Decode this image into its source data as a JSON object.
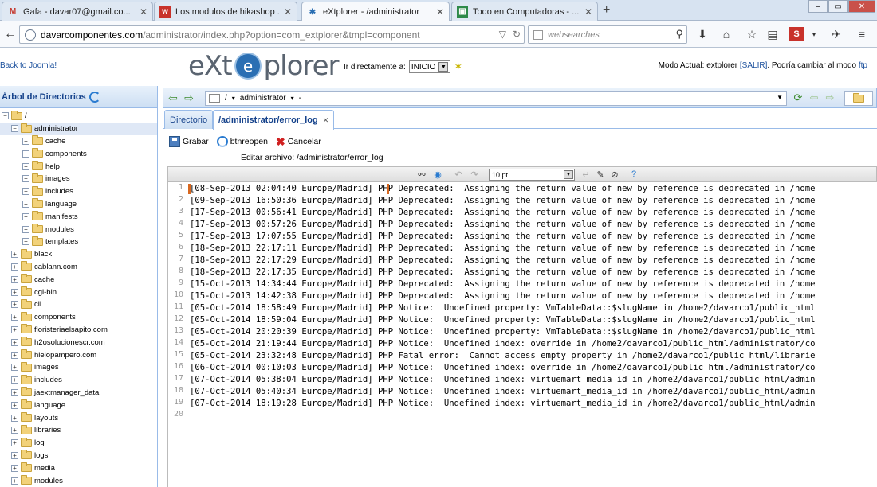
{
  "browser": {
    "tabs": [
      {
        "title": "Gafa - davar07@gmail.co...",
        "icon": "gmail-icon",
        "active": false
      },
      {
        "title": "Los modulos de hikashop ...",
        "icon": "site-icon",
        "active": false
      },
      {
        "title": "eXtplorer - /administrator",
        "icon": "extplorer-icon",
        "active": true
      },
      {
        "title": "Todo en Computadoras - ...",
        "icon": "page-icon",
        "active": false
      }
    ],
    "url_host": "davarcomponentes.com",
    "url_path": "/administrator/index.php?option=com_extplorer&tmpl=component",
    "search_placeholder": "websearches"
  },
  "header": {
    "back_link": "Back to Joomla!",
    "logo_left": "eXt",
    "logo_right": "plorer",
    "goto_label": "Ir directamente a:",
    "goto_value": "INICIO",
    "mode_prefix": "Modo Actual: extplorer",
    "mode_salir": "[SALIR]",
    "mode_middle": ". Podría cambiar al modo",
    "mode_ftp": "ftp"
  },
  "tree": {
    "title": "Árbol de Directorios",
    "root": "/",
    "selected": "administrator",
    "admin_children": [
      "cache",
      "components",
      "help",
      "images",
      "includes",
      "language",
      "manifests",
      "modules",
      "templates"
    ],
    "root_children": [
      "black",
      "cablann.com",
      "cache",
      "cgi-bin",
      "cli",
      "components",
      "floristeriaelsapito.com",
      "h2osolucionescr.com",
      "hielopampero.com",
      "images",
      "includes",
      "jaextmanager_data",
      "language",
      "layouts",
      "libraries",
      "log",
      "logs",
      "media",
      "modules"
    ]
  },
  "main": {
    "path_root": "/",
    "path_dir": "administrator",
    "path_sep": "-",
    "tab_directory": "Directorio",
    "tab_file": "/administrator/error_log",
    "save_label": "Grabar",
    "reopen_label": "btnreopen",
    "cancel_label": "Cancelar",
    "edit_label": "Editar archivo: /administrator/error_log",
    "font_size": "10 pt"
  },
  "editor": {
    "lines": [
      "[08-Sep-2013 02:04:40 Europe/Madrid] PHP Deprecated:  Assigning the return value of new by reference is deprecated in /home",
      "[09-Sep-2013 16:50:36 Europe/Madrid] PHP Deprecated:  Assigning the return value of new by reference is deprecated in /home",
      "[17-Sep-2013 00:56:41 Europe/Madrid] PHP Deprecated:  Assigning the return value of new by reference is deprecated in /home",
      "[17-Sep-2013 00:57:26 Europe/Madrid] PHP Deprecated:  Assigning the return value of new by reference is deprecated in /home",
      "[17-Sep-2013 17:07:55 Europe/Madrid] PHP Deprecated:  Assigning the return value of new by reference is deprecated in /home",
      "[18-Sep-2013 22:17:11 Europe/Madrid] PHP Deprecated:  Assigning the return value of new by reference is deprecated in /home",
      "[18-Sep-2013 22:17:29 Europe/Madrid] PHP Deprecated:  Assigning the return value of new by reference is deprecated in /home",
      "[18-Sep-2013 22:17:35 Europe/Madrid] PHP Deprecated:  Assigning the return value of new by reference is deprecated in /home",
      "[15-Oct-2013 14:34:44 Europe/Madrid] PHP Deprecated:  Assigning the return value of new by reference is deprecated in /home",
      "[15-Oct-2013 14:42:38 Europe/Madrid] PHP Deprecated:  Assigning the return value of new by reference is deprecated in /home",
      "[05-Oct-2014 18:58:49 Europe/Madrid] PHP Notice:  Undefined property: VmTableData::$slugName in /home2/davarco1/public_html",
      "[05-Oct-2014 18:59:04 Europe/Madrid] PHP Notice:  Undefined property: VmTableData::$slugName in /home2/davarco1/public_html",
      "[05-Oct-2014 20:20:39 Europe/Madrid] PHP Notice:  Undefined property: VmTableData::$slugName in /home2/davarco1/public_html",
      "[05-Oct-2014 21:19:44 Europe/Madrid] PHP Notice:  Undefined index: override in /home2/davarco1/public_html/administrator/co",
      "[05-Oct-2014 23:32:48 Europe/Madrid] PHP Fatal error:  Cannot access empty property in /home2/davarco1/public_html/librarie",
      "[06-Oct-2014 00:10:03 Europe/Madrid] PHP Notice:  Undefined index: override in /home2/davarco1/public_html/administrator/co",
      "[07-Oct-2014 05:38:04 Europe/Madrid] PHP Notice:  Undefined index: virtuemart_media_id in /home2/davarco1/public_html/admin",
      "[07-Oct-2014 05:40:34 Europe/Madrid] PHP Notice:  Undefined index: virtuemart_media_id in /home2/davarco1/public_html/admin",
      "[07-Oct-2014 18:19:28 Europe/Madrid] PHP Notice:  Undefined index: virtuemart_media_id in /home2/davarco1/public_html/admin",
      ""
    ]
  }
}
